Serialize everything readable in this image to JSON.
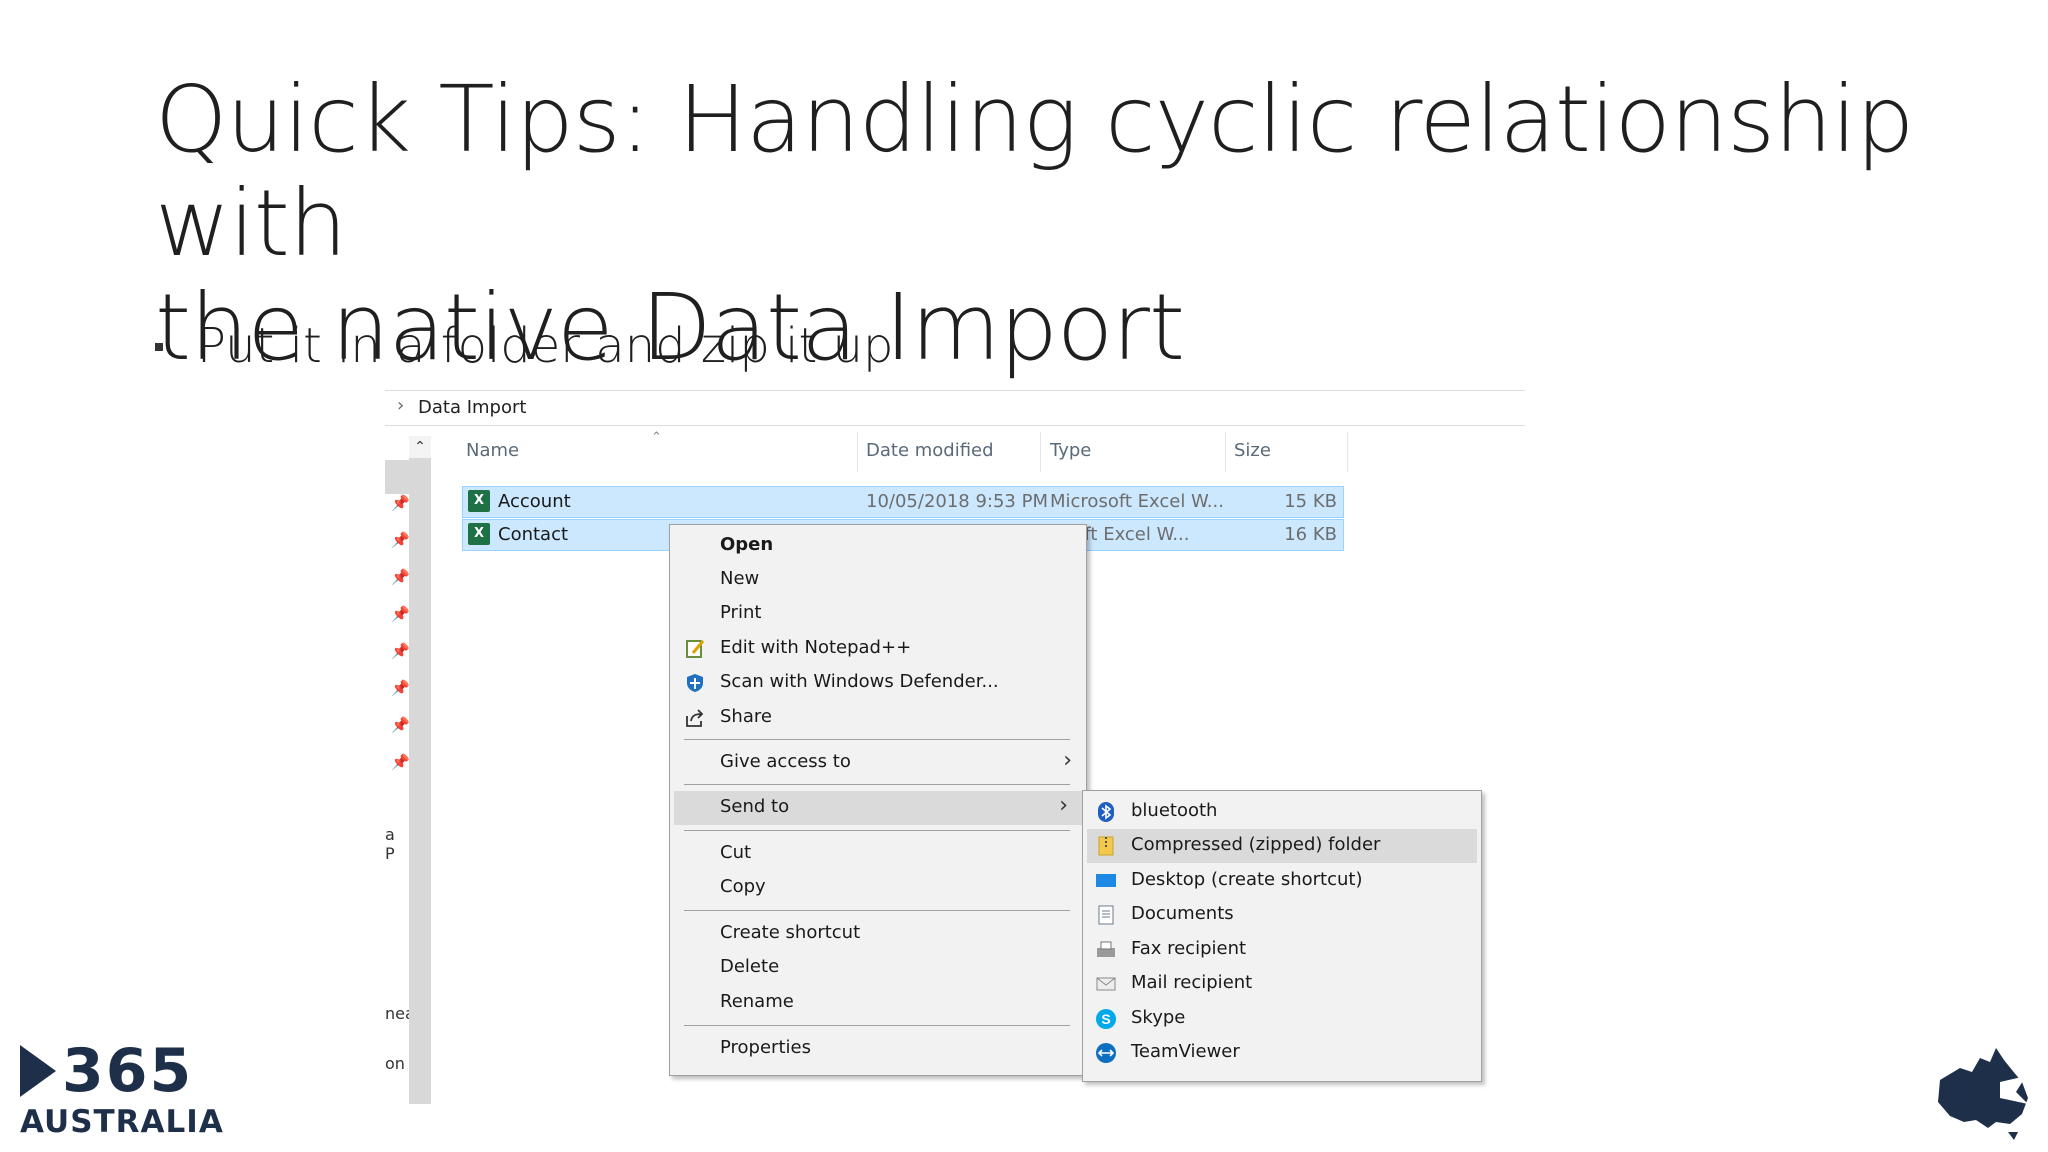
{
  "slide": {
    "title_line1": "Quick Tips: Handling cyclic relationship with",
    "title_line2": "the native Data Import",
    "bullet": "Put it in a folder and zip it up"
  },
  "explorer": {
    "breadcrumb": "Data Import",
    "nav_fragments": [
      "a P",
      "nea",
      "on"
    ],
    "columns": {
      "name": "Name",
      "date": "Date modified",
      "type": "Type",
      "size": "Size"
    },
    "files": [
      {
        "name": "Account",
        "date": "10/05/2018 9:53 PM",
        "type": "Microsoft Excel W...",
        "size": "15 KB",
        "icon": "excel-icon"
      },
      {
        "name": "Contact",
        "date": "",
        "type": "osoft Excel W...",
        "size": "16 KB",
        "icon": "excel-icon"
      }
    ]
  },
  "context_menu": {
    "open": "Open",
    "new": "New",
    "print": "Print",
    "edit_notepad": "Edit with Notepad++",
    "scan_defender": "Scan with Windows Defender...",
    "share": "Share",
    "give_access": "Give access to",
    "send_to": "Send to",
    "cut": "Cut",
    "copy": "Copy",
    "create_shortcut": "Create shortcut",
    "delete": "Delete",
    "rename": "Rename",
    "properties": "Properties"
  },
  "send_to_menu": {
    "bluetooth": "bluetooth",
    "compressed": "Compressed (zipped) folder",
    "desktop": "Desktop (create shortcut)",
    "documents": "Documents",
    "fax": "Fax recipient",
    "mail": "Mail recipient",
    "skype": "Skype",
    "teamviewer": "TeamViewer"
  },
  "brand": {
    "logo_number": "365",
    "logo_country": "AUSTRALIA",
    "primary_color": "#1e2f4a",
    "selection_color": "#cce8ff"
  }
}
